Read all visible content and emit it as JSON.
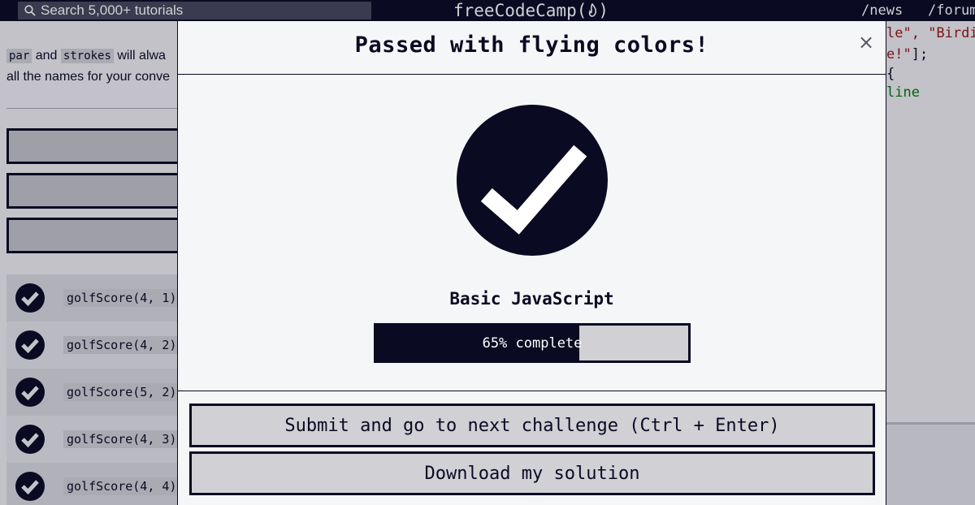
{
  "nav": {
    "search_placeholder": "Search 5,000+ tutorials",
    "brand": "freeCodeCamp",
    "links": [
      "/news",
      "/forum"
    ]
  },
  "background": {
    "description": {
      "chip1": "par",
      "word_and": "and",
      "chip2": "strokes",
      "tail1": "will alwa",
      "line2": "all the names for your conve"
    },
    "tests": [
      {
        "code": "golfScore(4, 1)",
        "passed": true
      },
      {
        "code": "golfScore(4, 2)",
        "passed": true
      },
      {
        "code": "golfScore(5, 2)",
        "passed": true
      },
      {
        "code": "golfScore(4, 3)",
        "passed": true
      },
      {
        "code": "golfScore(4, 4)",
        "passed": true
      }
    ],
    "editor_lines": [
      {
        "t1": "le\", ",
        "t2": "\"Birdi"
      },
      {
        "t1": "e!\"",
        "t2": "];"
      },
      {
        "t1": "{",
        "t2": ""
      },
      {
        "t1": "line",
        "t2": ""
      }
    ]
  },
  "modal": {
    "title": "Passed with flying colors!",
    "close_label": "×",
    "block_name": "Basic JavaScript",
    "progress_percent": 65,
    "progress_text": "65% complete",
    "submit_label": "Submit and go to next challenge (Ctrl + Enter)",
    "download_label": "Download my solution"
  },
  "colors": {
    "primary": "#0a0a23",
    "surface": "#f5f6f7",
    "button_bg": "#d0d0d5",
    "string_red": "#a31515",
    "comment_green": "#008000"
  }
}
